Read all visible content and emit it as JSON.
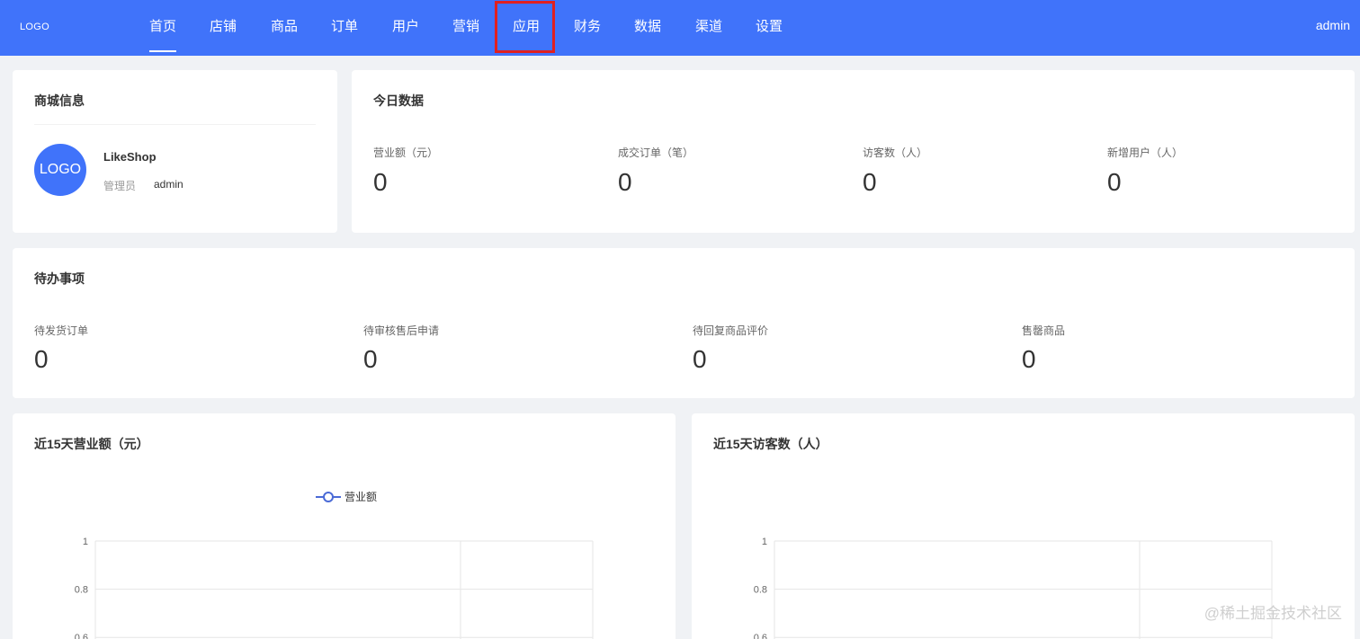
{
  "header": {
    "logo": "LOGO",
    "nav": [
      {
        "label": "首页",
        "active": true
      },
      {
        "label": "店铺"
      },
      {
        "label": "商品"
      },
      {
        "label": "订单"
      },
      {
        "label": "用户"
      },
      {
        "label": "营销"
      },
      {
        "label": "应用",
        "highlighted": true
      },
      {
        "label": "财务"
      },
      {
        "label": "数据"
      },
      {
        "label": "渠道"
      },
      {
        "label": "设置"
      }
    ],
    "user": "admin",
    "bg_color": "#4073fa",
    "highlight_color": "#e02020"
  },
  "shop_info": {
    "title": "商城信息",
    "avatar_text": "LOGO",
    "name": "LikeShop",
    "admin_label": "管理员",
    "admin_value": "admin"
  },
  "today": {
    "title": "今日数据",
    "stats": [
      {
        "label": "营业额（元）",
        "value": "0"
      },
      {
        "label": "成交订单（笔）",
        "value": "0"
      },
      {
        "label": "访客数（人）",
        "value": "0"
      },
      {
        "label": "新增用户（人）",
        "value": "0"
      }
    ]
  },
  "todo": {
    "title": "待办事项",
    "items": [
      {
        "label": "待发货订单",
        "value": "0"
      },
      {
        "label": "待审核售后申请",
        "value": "0"
      },
      {
        "label": "待回复商品评价",
        "value": "0"
      },
      {
        "label": "售罄商品",
        "value": "0"
      }
    ]
  },
  "charts_meta": {
    "revenue_title": "近15天营业额（元）",
    "visitors_title": "近15天访客数（人）"
  },
  "chart_data": [
    {
      "type": "line",
      "title": "近15天营业额（元）",
      "legend": [
        "营业额"
      ],
      "legend_placement": "top-center",
      "y_ticks": [
        "1",
        "0.8",
        "0.6"
      ],
      "ylim": [
        0,
        1
      ],
      "grid": true,
      "series": [
        {
          "name": "营业额",
          "values": []
        }
      ],
      "line_color": "#4a6ad6"
    },
    {
      "type": "line",
      "title": "近15天访客数（人）",
      "y_ticks": [
        "1",
        "0.8",
        "0.6"
      ],
      "ylim": [
        0,
        1
      ],
      "grid": true,
      "series": []
    }
  ],
  "watermark": "@稀土掘金技术社区"
}
